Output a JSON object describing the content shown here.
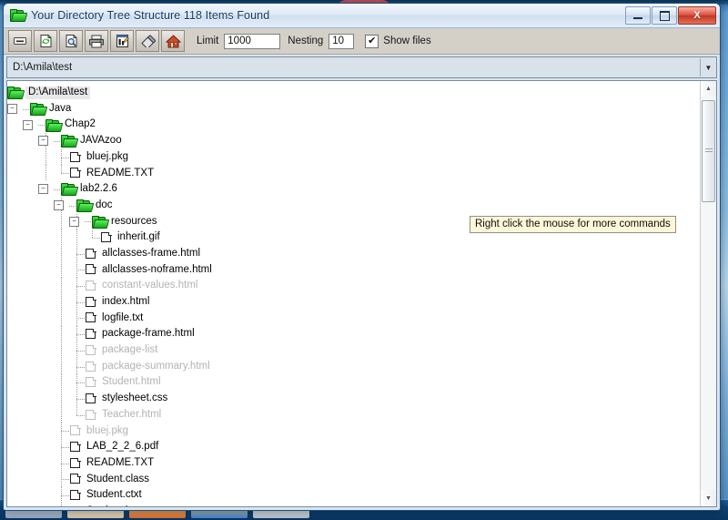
{
  "window": {
    "title": "Your Directory Tree Structure 118 Items Found",
    "icon": "folder-open-icon",
    "minimize_label": "Minimize",
    "maximize_label": "Maximize",
    "close_label": "X"
  },
  "toolbar": {
    "buttons": [
      {
        "name": "collapse-all-button",
        "icon": "minus-box-icon"
      },
      {
        "name": "refresh-button",
        "icon": "refresh-page-icon"
      },
      {
        "name": "preview-button",
        "icon": "magnifier-page-icon"
      },
      {
        "name": "print-button",
        "icon": "printer-icon"
      },
      {
        "name": "edit-report-button",
        "icon": "document-pen-icon"
      },
      {
        "name": "eraser-button",
        "icon": "eraser-icon"
      },
      {
        "name": "home-button",
        "icon": "house-icon"
      }
    ],
    "limit_label": "Limit",
    "limit_value": "1000",
    "nesting_label": "Nesting",
    "nesting_value": "10",
    "show_files_label": "Show files",
    "show_files_checked": true,
    "checkmark": "✔"
  },
  "pathbar": {
    "value": "D:\\Amila\\test",
    "dropdown_icon": "chevron-down-icon"
  },
  "tooltip": {
    "text": "Right click the mouse for more commands"
  },
  "tree": {
    "rows": [
      {
        "label": "D:\\Amila\\test",
        "type": "folder",
        "depth": 0,
        "knob": "",
        "selected": true,
        "dim": false
      },
      {
        "label": "Java",
        "type": "folder",
        "depth": 1,
        "knob": "−",
        "selected": false,
        "dim": false
      },
      {
        "label": "Chap2",
        "type": "folder",
        "depth": 2,
        "knob": "−",
        "selected": false,
        "dim": false
      },
      {
        "label": "JAVAzoo",
        "type": "folder",
        "depth": 3,
        "knob": "−",
        "selected": false,
        "dim": false
      },
      {
        "label": "bluej.pkg",
        "type": "file",
        "depth": 4,
        "knob": "",
        "selected": false,
        "dim": false
      },
      {
        "label": "README.TXT",
        "type": "file",
        "depth": 4,
        "knob": "",
        "selected": false,
        "dim": false
      },
      {
        "label": "lab2.2.6",
        "type": "folder",
        "depth": 3,
        "knob": "−",
        "selected": false,
        "dim": false
      },
      {
        "label": "doc",
        "type": "folder",
        "depth": 4,
        "knob": "−",
        "selected": false,
        "dim": false
      },
      {
        "label": "resources",
        "type": "folder",
        "depth": 5,
        "knob": "−",
        "selected": false,
        "dim": false
      },
      {
        "label": "inherit.gif",
        "type": "file",
        "depth": 6,
        "knob": "",
        "selected": false,
        "dim": false
      },
      {
        "label": "allclasses-frame.html",
        "type": "file",
        "depth": 5,
        "knob": "",
        "selected": false,
        "dim": false
      },
      {
        "label": "allclasses-noframe.html",
        "type": "file",
        "depth": 5,
        "knob": "",
        "selected": false,
        "dim": false
      },
      {
        "label": "constant-values.html",
        "type": "file",
        "depth": 5,
        "knob": "",
        "selected": false,
        "dim": true
      },
      {
        "label": "index.html",
        "type": "file",
        "depth": 5,
        "knob": "",
        "selected": false,
        "dim": false
      },
      {
        "label": "logfile.txt",
        "type": "file",
        "depth": 5,
        "knob": "",
        "selected": false,
        "dim": false
      },
      {
        "label": "package-frame.html",
        "type": "file",
        "depth": 5,
        "knob": "",
        "selected": false,
        "dim": false
      },
      {
        "label": "package-list",
        "type": "file",
        "depth": 5,
        "knob": "",
        "selected": false,
        "dim": true
      },
      {
        "label": "package-summary.html",
        "type": "file",
        "depth": 5,
        "knob": "",
        "selected": false,
        "dim": true
      },
      {
        "label": "Student.html",
        "type": "file",
        "depth": 5,
        "knob": "",
        "selected": false,
        "dim": true
      },
      {
        "label": "stylesheet.css",
        "type": "file",
        "depth": 5,
        "knob": "",
        "selected": false,
        "dim": false
      },
      {
        "label": "Teacher.html",
        "type": "file",
        "depth": 5,
        "knob": "",
        "selected": false,
        "dim": true
      },
      {
        "label": "bluej.pkg",
        "type": "file",
        "depth": 4,
        "knob": "",
        "selected": false,
        "dim": true
      },
      {
        "label": "LAB_2_2_6.pdf",
        "type": "file",
        "depth": 4,
        "knob": "",
        "selected": false,
        "dim": false
      },
      {
        "label": "README.TXT",
        "type": "file",
        "depth": 4,
        "knob": "",
        "selected": false,
        "dim": false
      },
      {
        "label": "Student.class",
        "type": "file",
        "depth": 4,
        "knob": "",
        "selected": false,
        "dim": false
      },
      {
        "label": "Student.ctxt",
        "type": "file",
        "depth": 4,
        "knob": "",
        "selected": false,
        "dim": false
      },
      {
        "label": "Student.java",
        "type": "file",
        "depth": 4,
        "knob": "",
        "selected": false,
        "dim": false
      }
    ]
  },
  "scrollbar": {
    "up_icon": "triangle-up-icon",
    "down_icon": "triangle-down-icon"
  }
}
